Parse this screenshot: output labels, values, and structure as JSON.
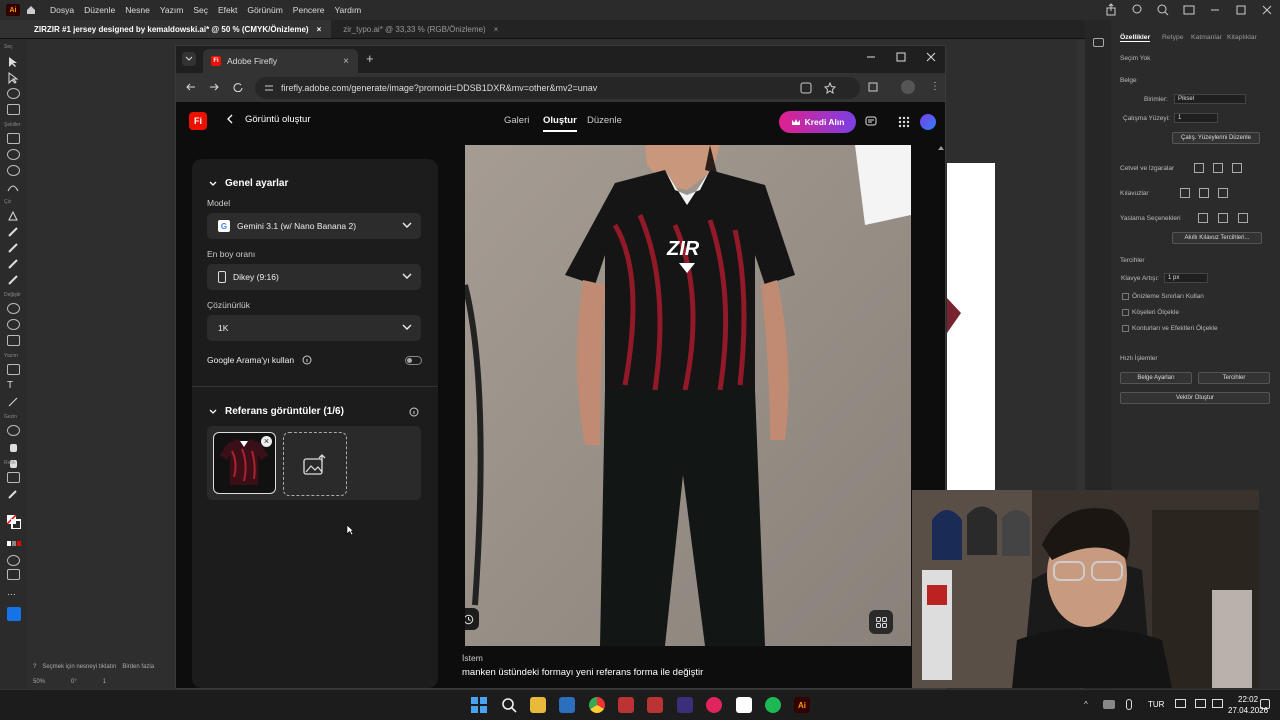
{
  "illustrator": {
    "logo": "Ai",
    "menu": [
      "Dosya",
      "Düzenle",
      "Nesne",
      "Yazım",
      "Seç",
      "Efekt",
      "Görünüm",
      "Pencere",
      "Yardım"
    ],
    "doc_tabs": [
      {
        "label": "ZIRZIR #1 jersey designed by kemaldowski.ai* @ 50 % (CMYK/Önizleme)",
        "active": true
      },
      {
        "label": "zir_typo.ai* @ 33,33 % (RGB/Önizleme)",
        "active": false
      }
    ],
    "tool_groups": [
      "Seç",
      "Şekiller",
      "Çiz",
      "Değiştir",
      "Yazım",
      "Gezin",
      "Renk"
    ],
    "status": {
      "hint": "Seçmek için nesneyi tıklatın",
      "hint2": "Birden fazla",
      "zoom": "50%",
      "rotation": "0°",
      "artboard": "1"
    },
    "props": {
      "tabs": [
        "Özellikler",
        "Retype",
        "Katmanlar",
        "Kitaplıklar"
      ],
      "no_selection": "Seçim Yok",
      "document": "Belge",
      "units_label": "Birimler:",
      "units_value": "Piksel",
      "artboard_label": "Çalışma Yüzeyi:",
      "artboard_value": "1",
      "edit_artboards": "Çalış. Yüzeylerini Düzenle",
      "rulers_grids": "Cetvel ve Izgaralar",
      "guides": "Kılavuzlar",
      "align_options": "Yaslama Seçenekleri",
      "smart_guides": "Akıllı Kılavuz Tercihleri...",
      "preferences": "Tercihler",
      "keyboard_inc_label": "Klavye Artışı:",
      "keyboard_inc_value": "1 px",
      "check1": "Önizleme Sınırları Kullan",
      "check2": "Köşeleri Ölçekle",
      "check3": "Konturları ve Efektleri Ölçekle",
      "quick_actions": "Hızlı İşlemler",
      "doc_setup": "Belge Ayarları",
      "prefs_btn": "Tercihler",
      "vector_btn": "Vektör Oluştur"
    }
  },
  "chrome": {
    "tab_title": "Adobe Firefly",
    "url": "firefly.adobe.com/generate/image?promoid=DDSB1DXR&mv=other&mv2=unav"
  },
  "firefly": {
    "logo": "Fi",
    "page_title": "Görüntü oluştur",
    "nav": [
      "Galeri",
      "Oluştur",
      "Düzenle"
    ],
    "credits_button": "Kredi Alın",
    "general_settings": "Genel ayarlar",
    "model_label": "Model",
    "model_value": "Gemini 3.1 (w/ Nano Banana 2)",
    "aspect_label": "En boy oranı",
    "aspect_value": "Dikey (9:16)",
    "resolution_label": "Çözünürlük",
    "resolution_value": "1K",
    "google_search_label": "Google Arama'yı kullan",
    "google_search_on": false,
    "reference_title": "Referans görüntüler (1/6)",
    "prompt_label": "İstem",
    "prompt_text": "manken üstündeki formayı yeni referans forma ile değiştir",
    "jersey_logo": "ZIR"
  },
  "taskbar": {
    "language": "TUR",
    "time": "22:02",
    "date": "27.04.2026"
  },
  "colors": {
    "firefly_red": "#eb1000",
    "credits_gradient_start": "#e0208e",
    "credits_gradient_end": "#7b3fe4"
  }
}
